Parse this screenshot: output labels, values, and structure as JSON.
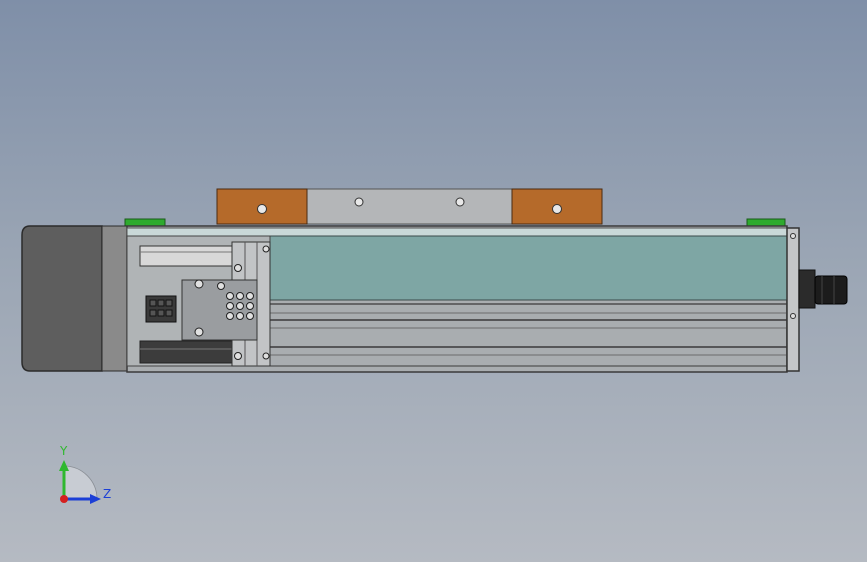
{
  "triad": {
    "y_label": "Y",
    "z_label": "Z",
    "colors": {
      "y": "#2fb82f",
      "z": "#1c3fd6",
      "origin": "#d42020"
    }
  },
  "colors": {
    "background_top": "#7f8fa8",
    "background_bottom": "#b5bac2",
    "motor": "#5e5e5e",
    "rail_cover": "#7ea6a4",
    "carriage_block": "#b9822f",
    "carriage_plate": "#b4b6b8",
    "end_cap": "#2eaa2e"
  }
}
